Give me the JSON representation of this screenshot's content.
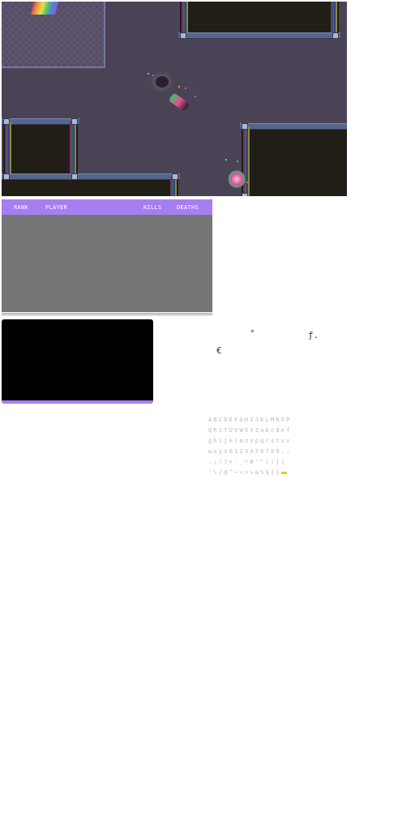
{
  "scoreboard": {
    "columns": {
      "rank": "RANK",
      "player": "PLAYER",
      "kills": "KILLS",
      "deaths": "DEATHS"
    },
    "rows": []
  },
  "glyphs": {
    "degree": "°",
    "florin": "ƒ.",
    "euro": "€"
  },
  "font_sheet": {
    "rows": [
      "ABCDEFGHIJKLMNOP",
      "QRSTUVWXYZabcdef",
      "ghijklmnopqrstuv",
      "wxyz0123456789.,",
      ":;!?+-_*#'\"()[]",
      "'\\/@^~<=>&%${}"
    ]
  },
  "colors": {
    "arena_floor": "#4a4356",
    "room_fill": "#211d17",
    "accent_purple": "#a77ef2",
    "scoreboard_body": "#767676",
    "font_highlight": "#e9c43c"
  }
}
